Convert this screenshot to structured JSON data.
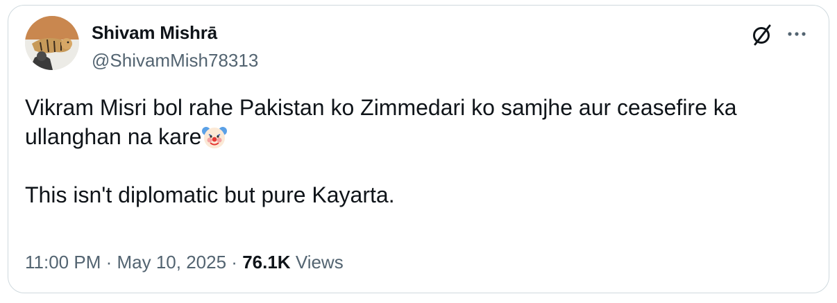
{
  "author": {
    "display_name": "Shivam Mishrā",
    "handle": "@ShivamMish78313",
    "avatar_icon": "tiger-photo-avatar"
  },
  "header_actions": {
    "grok_icon": "slashed-circle-icon",
    "more_icon": "ellipsis-icon"
  },
  "tweet": {
    "line1": "Vikram Misri bol rahe Pakistan ko Zimmedari ko samjhe aur ceasefire ka ullanghan na kare",
    "emoji": "clown-face-emoji",
    "line2": "This isn't diplomatic but pure Kayarta."
  },
  "meta": {
    "time": "11:00 PM",
    "separator": "·",
    "date": "May 10, 2025",
    "views_count": "76.1K",
    "views_label": "Views"
  },
  "colors": {
    "text_primary": "#0f1419",
    "text_secondary": "#536471",
    "border": "#cfd9de"
  }
}
